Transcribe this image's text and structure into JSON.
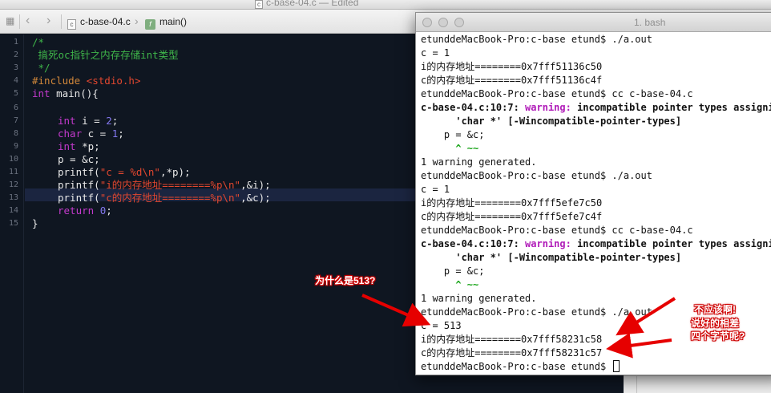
{
  "editor": {
    "window_title": "c-base-04.c — Edited",
    "file_icon": "c-file-icon",
    "breadcrumb": {
      "file": "c-base-04.c",
      "function": "main()",
      "function_badge": "f"
    },
    "line_numbers": [
      "1",
      "2",
      "3",
      "4",
      "5",
      "6",
      "7",
      "8",
      "9",
      "10",
      "11",
      "12",
      "13",
      "14",
      "15"
    ],
    "code": {
      "l1": "/*",
      "l2": " 搞死oc指针之内存存储int类型",
      "l3": " */",
      "l4_pre": "#include ",
      "l4_inc": "<stdio.h>",
      "l5_kw": "int",
      "l5_rest": " main(){",
      "l7_kw": "int",
      "l7_a": " i = ",
      "l7_num": "2",
      "l7_b": ";",
      "l8_kw": "char",
      "l8_a": " c = ",
      "l8_num": "1",
      "l8_b": ";",
      "l9_kw": "int",
      "l9_a": " *p;",
      "l10": "p = &c;",
      "l11_a": "printf(",
      "l11_str": "\"c = %d\\n\"",
      "l11_b": ",*p);",
      "l12_a": "printf(",
      "l12_str": "\"i的内存地址========%p\\n\"",
      "l12_b": ",&i);",
      "l13_a": "printf(",
      "l13_str": "\"c的内存地址========%p\\n\"",
      "l13_b": ",&c);",
      "l14_kw": "return",
      "l14_num": "0",
      "l14_b": ";",
      "l15": "}"
    }
  },
  "terminal": {
    "title": "1. bash",
    "lines": {
      "t1": "etunddeMacBook-Pro:c-base etund$ ./a.out",
      "t2": "c = 1",
      "t3": "i的内存地址========0x7fff51136c50",
      "t4": "c的内存地址========0x7fff51136c4f",
      "t5": "etunddeMacBook-Pro:c-base etund$ cc c-base-04.c",
      "t6_loc": "c-base-04.c:10:7: ",
      "t6_warn": "warning:",
      "t6_msg": " incompatible pointer types assigning",
      "t7": "      'char *' [-Wincompatible-pointer-types]",
      "t8": "    p = &c;",
      "t9": "      ^ ~~",
      "t10": "1 warning generated.",
      "t11": "etunddeMacBook-Pro:c-base etund$ ./a.out",
      "t12": "c = 1",
      "t13": "i的内存地址========0x7fff5efe7c50",
      "t14": "c的内存地址========0x7fff5efe7c4f",
      "t15": "etunddeMacBook-Pro:c-base etund$ cc c-base-04.c",
      "t16_loc": "c-base-04.c:10:7: ",
      "t16_warn": "warning:",
      "t16_msg": " incompatible pointer types assigning",
      "t17": "      'char *' [-Wincompatible-pointer-types]",
      "t18": "    p = &c;",
      "t19": "      ^ ~~",
      "t20": "1 warning generated.",
      "t21": "etunddeMacBook-Pro:c-base etund$ ./a.out",
      "t22": "c = 513",
      "t23": "i的内存地址========0x7fff58231c58",
      "t24": "c的内存地址========0x7fff58231c57",
      "t25": "etunddeMacBook-Pro:c-base etund$ "
    }
  },
  "annotations": {
    "why": "为什么是513?",
    "note_1": "不应该啊!",
    "note_2": "说好的相差",
    "note_3": "四个字节呢?"
  },
  "colors": {
    "editor_bg": "#0f1621",
    "comment": "#3fb64a",
    "keyword": "#c43acd",
    "string": "#e2472f",
    "number": "#8277ee",
    "warning": "#b01ab8",
    "annotation": "#e60000"
  }
}
